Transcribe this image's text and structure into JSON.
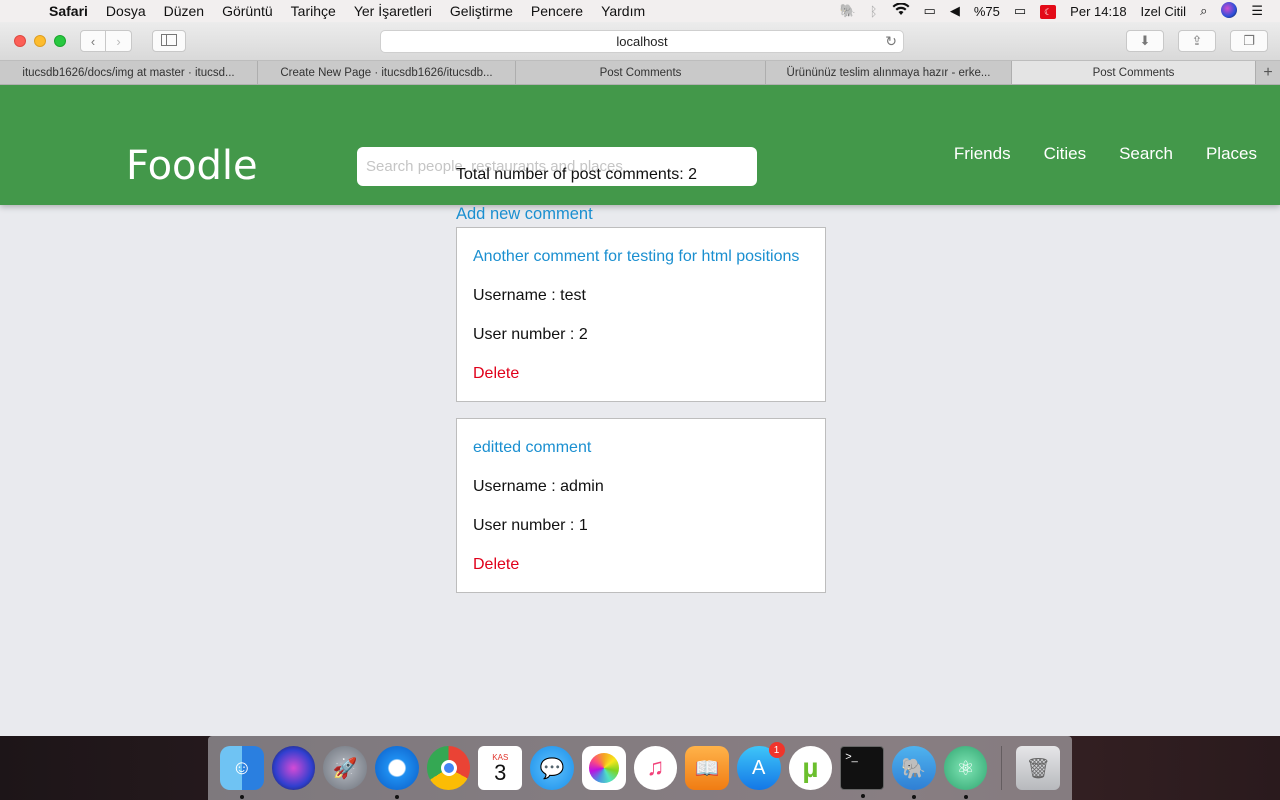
{
  "menubar": {
    "apple_icon": "apple-icon",
    "items": [
      "Safari",
      "Dosya",
      "Düzen",
      "Görüntü",
      "Tarihçe",
      "Yer İşaretleri",
      "Geliştirme",
      "Pencere",
      "Yardım"
    ],
    "battery": "%75",
    "clock": "Per 14:18",
    "user": "Izel Citil"
  },
  "browser": {
    "url": "localhost",
    "tabs": [
      {
        "label": "itucsdb1626/docs/img at master · itucsd..."
      },
      {
        "label": "Create New Page · itucsdb1626/itucsdb..."
      },
      {
        "label": "Post Comments"
      },
      {
        "label": "Ürününüz teslim alınmaya hazır - erke..."
      },
      {
        "label": "Post Comments"
      }
    ],
    "new_tab_label": "+"
  },
  "site": {
    "brand": "Foodle",
    "search_placeholder": "Search people, restaurants and places",
    "nav": [
      "Friends",
      "Cities",
      "Search",
      "Places"
    ]
  },
  "main": {
    "total_text": "Total number of post comments: 2",
    "add_link": "Add new comment",
    "comments": [
      {
        "title": "Another comment for testing for html positions",
        "username": "Username : test",
        "user_number": "User number : 2",
        "delete": "Delete"
      },
      {
        "title": "editted comment",
        "username": "Username : admin",
        "user_number": "User number : 1",
        "delete": "Delete"
      }
    ]
  },
  "dock": {
    "app_store_badge": "1",
    "calendar_month": "KAS",
    "calendar_day": "3"
  },
  "colors": {
    "navbar": "#43984a",
    "link": "#1a8fd0",
    "delete": "#e0001a"
  }
}
